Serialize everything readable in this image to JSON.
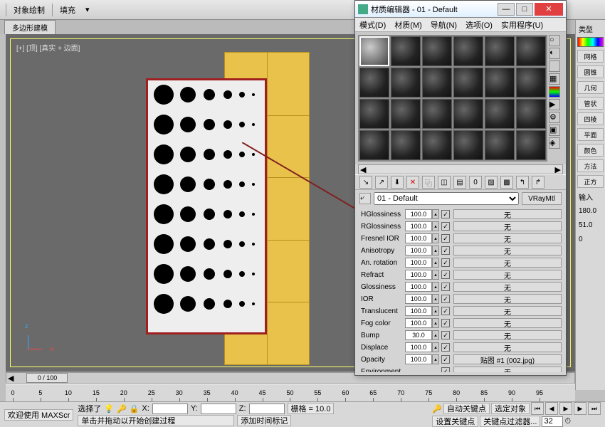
{
  "mainToolbar": {
    "label1": "对象绘制",
    "label2": "填充"
  },
  "tabStrip": {
    "tab1": "多边形建模"
  },
  "viewport": {
    "label": "[+] [顶] [真实 + 边面]",
    "axisZ": "z",
    "axisX": "x"
  },
  "materialEditor": {
    "title": "材质编辑器 - 01 - Default",
    "menu": [
      "模式(D)",
      "材质(M)",
      "导航(N)",
      "选项(O)",
      "实用程序(U)"
    ],
    "scrollLeft": "◀",
    "scrollRight": "▶",
    "matName": "01 - Default",
    "matType": "VRayMtl",
    "params": [
      {
        "label": "HGlossiness",
        "val": "100.0",
        "chk": true,
        "map": "无"
      },
      {
        "label": "RGlossiness",
        "val": "100.0",
        "chk": true,
        "map": "无"
      },
      {
        "label": "Fresnel IOR",
        "val": "100.0",
        "chk": true,
        "map": "无"
      },
      {
        "label": "Anisotropy",
        "val": "100.0",
        "chk": true,
        "map": "无"
      },
      {
        "label": "An. rotation",
        "val": "100.0",
        "chk": true,
        "map": "无"
      },
      {
        "label": "Refract",
        "val": "100.0",
        "chk": true,
        "map": "无"
      },
      {
        "label": "Glossiness",
        "val": "100.0",
        "chk": true,
        "map": "无"
      },
      {
        "label": "IOR",
        "val": "100.0",
        "chk": true,
        "map": "无"
      },
      {
        "label": "Translucent",
        "val": "100.0",
        "chk": true,
        "map": "无"
      },
      {
        "label": "Fog color",
        "val": "100.0",
        "chk": true,
        "map": "无"
      },
      {
        "label": "Bump",
        "val": "30.0",
        "chk": true,
        "map": "无"
      },
      {
        "label": "Displace",
        "val": "100.0",
        "chk": true,
        "map": "无"
      },
      {
        "label": "Opacity",
        "val": "100.0",
        "chk": true,
        "map": "贴图 #1 (002.jpg)"
      },
      {
        "label": "Environment",
        "val": "",
        "chk": true,
        "map": "无"
      }
    ]
  },
  "rightPanel": {
    "items": [
      "类型",
      "网格",
      "圆锥",
      "几何",
      "管状",
      "四棱",
      "平面",
      "颜色",
      "方法",
      "正方",
      "输入",
      "180.0",
      "51.0",
      "0"
    ]
  },
  "timeline": {
    "thumb": "0 / 100",
    "ticks": [
      0,
      5,
      10,
      15,
      20,
      25,
      30,
      35,
      40,
      45,
      50,
      55,
      60,
      65,
      70,
      75,
      80,
      85,
      90,
      95
    ]
  },
  "status": {
    "welcome": "欢迎使用  MAXScr",
    "sel": "选择了",
    "selIco": "💡",
    "x": "X:",
    "y": "Y:",
    "z": "Z:",
    "grid": "栅格 = 10.0",
    "hint": "单击并拖动以开始创建过程",
    "addTag": "添加时间标记",
    "autoKey": "自动关键点",
    "selObj": "选定对象",
    "setKey": "设置关键点",
    "keyFilter": "关键点过滤器...",
    "frame": "32"
  }
}
